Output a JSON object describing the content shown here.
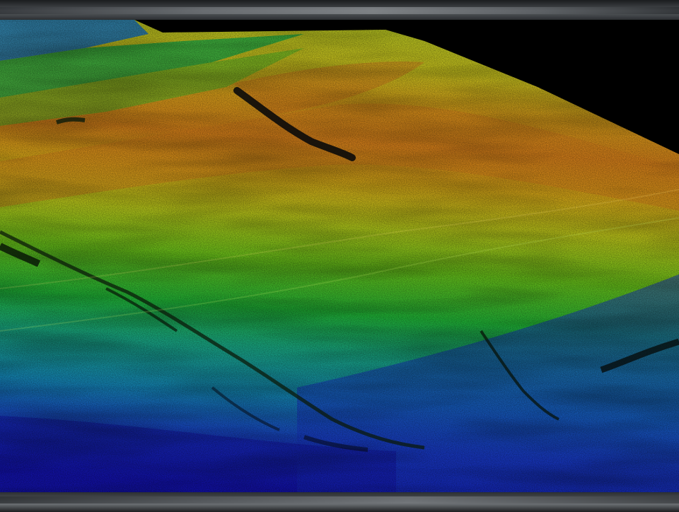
{
  "scene": {
    "subject": "lidar-terrain-elevation-surface",
    "elevation_colormap": [
      "#1a10c8",
      "#1a4fd6",
      "#1aa6b8",
      "#2cc24a",
      "#7ad21a",
      "#d8d21a",
      "#e8a21a",
      "#e06a1a"
    ],
    "background_color": "#000000",
    "frame_bar_color": "#4a4e52"
  }
}
